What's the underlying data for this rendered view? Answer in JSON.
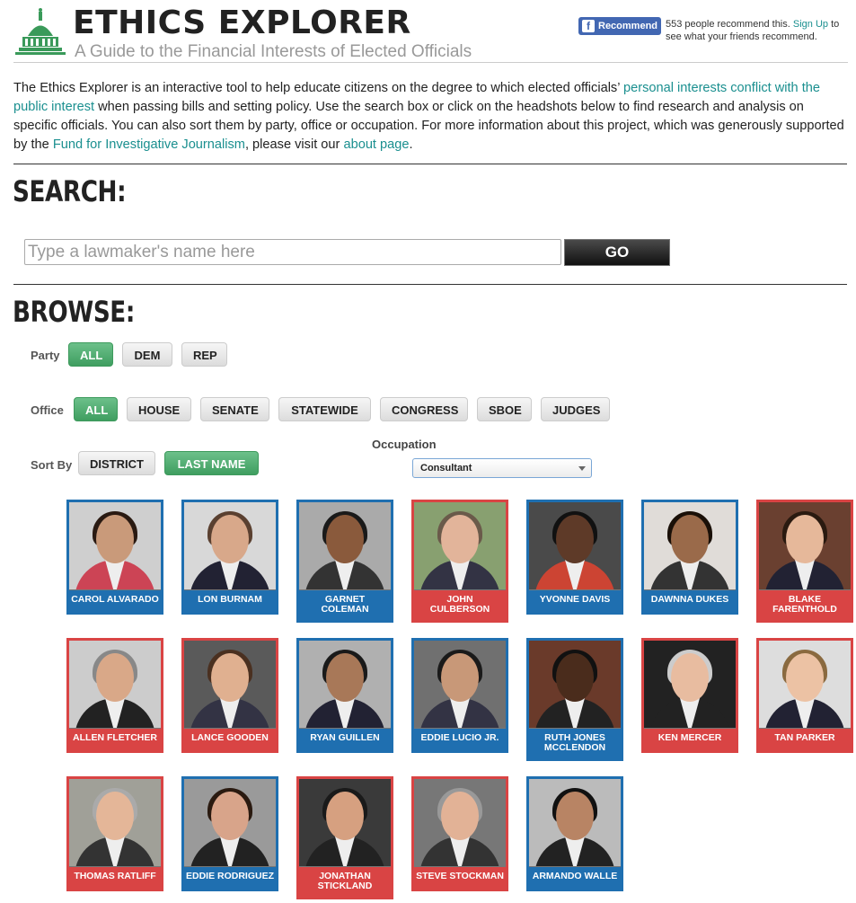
{
  "header": {
    "title": "ETHICS EXPLORER",
    "subtitle": "A Guide to the Financial Interests of Elected Officials",
    "fb_button_label": "Recommend",
    "fb_count_text": "553 people recommend this.",
    "fb_signup_link": "Sign Up",
    "fb_suffix_text": "to see what your friends recommend."
  },
  "intro": {
    "text1": "The Ethics Explorer is an interactive tool to help educate citizens on the degree to which elected officials’ ",
    "link1": "personal interests conflict with the public interest",
    "text2": " when passing bills and setting policy. Use the search box or click on the headshots below to find research and analysis on specific officials. You can also sort them by party, office or occupation. For more information about this project, which was generously supported by the ",
    "link2": "Fund for Investigative Journalism",
    "text3": ", please visit our ",
    "link3": "about page",
    "text4": "."
  },
  "search": {
    "heading": "SEARCH:",
    "placeholder": "Type a lawmaker's name here",
    "go_label": "GO"
  },
  "browse": {
    "heading": "BROWSE:",
    "party_label": "Party",
    "party_options": [
      "ALL",
      "DEM",
      "REP"
    ],
    "office_label": "Office",
    "office_options": [
      "ALL",
      "HOUSE",
      "SENATE",
      "STATEWIDE",
      "CONGRESS",
      "SBOE",
      "JUDGES"
    ],
    "sort_label": "Sort By",
    "sort_options": [
      "DISTRICT",
      "LAST NAME"
    ],
    "occupation_label": "Occupation",
    "occupation_selected": "Consultant"
  },
  "officials": [
    {
      "name": "CAROL ALVARADO",
      "party": "dem"
    },
    {
      "name": "LON BURNAM",
      "party": "dem"
    },
    {
      "name": "GARNET COLEMAN",
      "party": "dem"
    },
    {
      "name": "JOHN CULBERSON",
      "party": "rep"
    },
    {
      "name": "YVONNE DAVIS",
      "party": "dem"
    },
    {
      "name": "DAWNNA DUKES",
      "party": "dem"
    },
    {
      "name": "BLAKE FARENTHOLD",
      "party": "rep"
    },
    {
      "name": "ALLEN FLETCHER",
      "party": "rep"
    },
    {
      "name": "LANCE GOODEN",
      "party": "rep"
    },
    {
      "name": "RYAN GUILLEN",
      "party": "dem"
    },
    {
      "name": "EDDIE LUCIO JR.",
      "party": "dem"
    },
    {
      "name": "RUTH JONES MCCLENDON",
      "party": "dem"
    },
    {
      "name": "KEN MERCER",
      "party": "rep"
    },
    {
      "name": "TAN PARKER",
      "party": "rep"
    },
    {
      "name": "THOMAS RATLIFF",
      "party": "rep"
    },
    {
      "name": "EDDIE RODRIGUEZ",
      "party": "dem"
    },
    {
      "name": "JONATHAN STICKLAND",
      "party": "rep"
    },
    {
      "name": "STEVE STOCKMAN",
      "party": "rep"
    },
    {
      "name": "ARMANDO WALLE",
      "party": "dem"
    }
  ]
}
